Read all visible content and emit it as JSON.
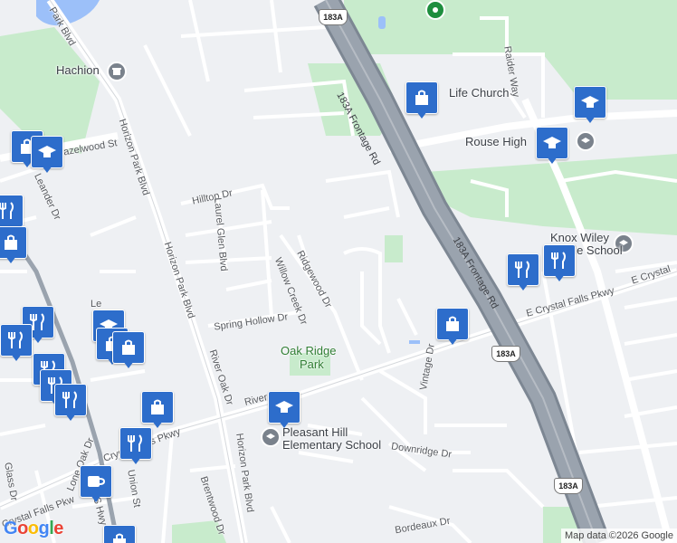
{
  "map": {
    "colors": {
      "land": "#eef0f3",
      "park": "#c8ebcc",
      "water": "#9cc0f9",
      "road": "#ffffff",
      "highway": "#9aa3ae",
      "marker": "#2d6dcb"
    },
    "places": {
      "hachion": "Hachion",
      "life_church": "Life Church",
      "rouse_high": "Rouse High",
      "knox_wiley_1": "Knox Wiley",
      "knox_wiley_2": "Middle School",
      "oak_ridge_1": "Oak Ridge",
      "oak_ridge_2": "Park",
      "pleasant_hill_1": "Pleasant Hill",
      "pleasant_hill_2": "Elementary School"
    },
    "roads": {
      "frontage_1": "183A Frontage Rd",
      "frontage_2": "183A Frontage Rd",
      "horizon_1": "Horizon Park Blvd",
      "horizon_2": "Horizon Park Blvd",
      "horizon_3": "Horizon Park Blvd",
      "horizon_top": "Park Blvd",
      "hazelwood": "Hazelwood St",
      "leander": "Leander Dr",
      "hilltop": "Hilltop Dr",
      "laurel_glen": "Laurel Glen Blvd",
      "ridgewood": "Ridgewood Dr",
      "willow_creek": "Willow Creek Dr",
      "spring_hollow": "Spring Hollow Dr",
      "river_oak": "River Oak Dr",
      "river_short": "River",
      "e_crystal_1": "E Crystal Falls Pkwy",
      "e_crystal_2": "E Crystal",
      "crystal_w1": "Crystal Falls Pkwy",
      "crystal_w2": "Crystal Falls Pkw",
      "vintage": "Vintage Dr",
      "downridge": "Downridge Dr",
      "raider": "Raider Way",
      "union": "Union St",
      "brentwood": "Brentwood Dr",
      "lone_oak": "Lone Oak Dr",
      "glass": "Glass Dr",
      "bordeaux": "Bordeaux Dr",
      "le": "Le",
      "s_hwy": "S Hwy"
    },
    "shields": [
      "183A",
      "183A",
      "183A"
    ],
    "credit": "Map data ©2026 Google",
    "logo": "Google"
  }
}
